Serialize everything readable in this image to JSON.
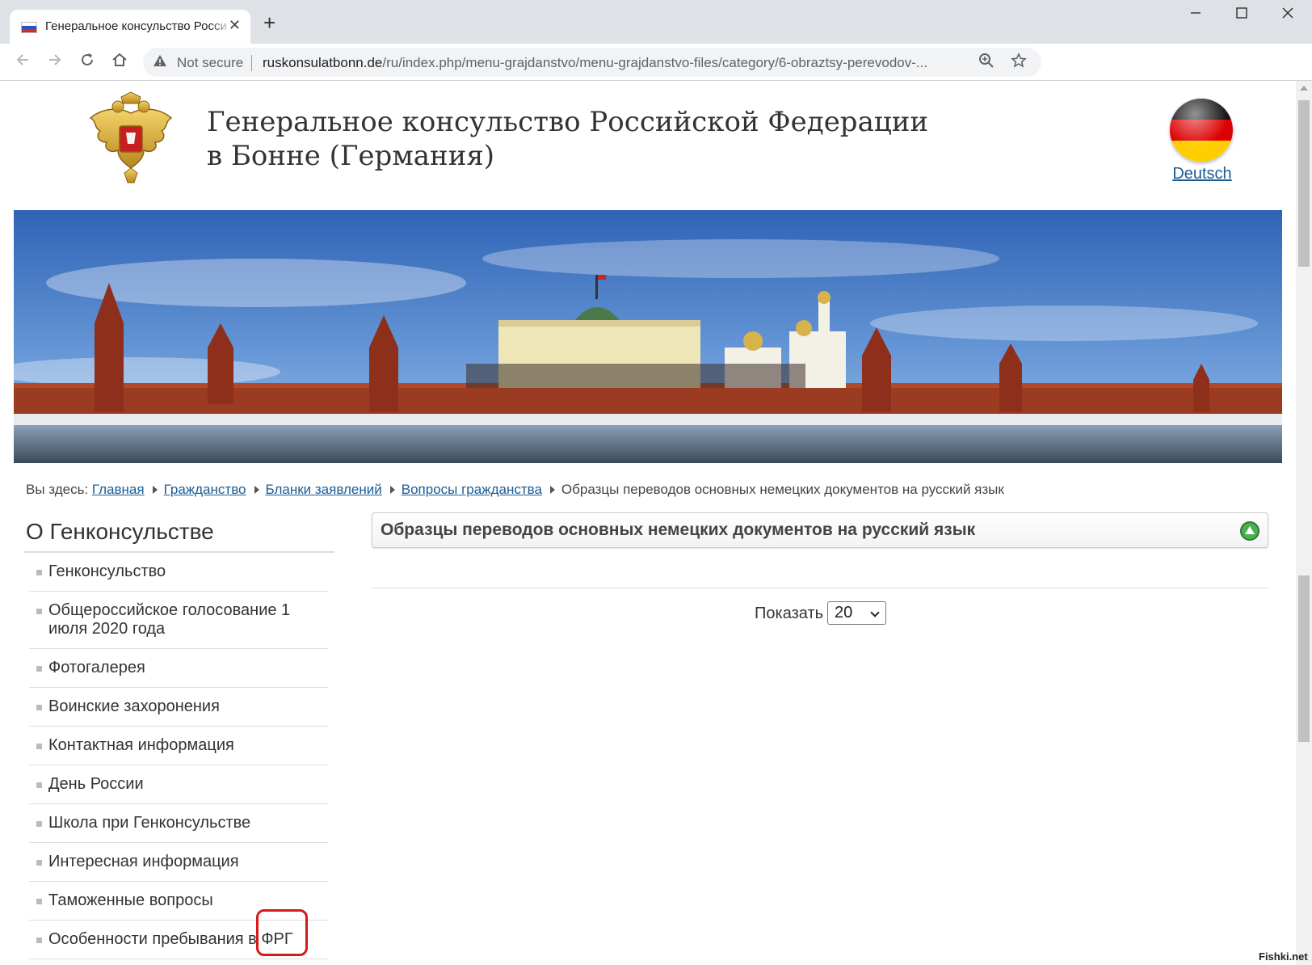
{
  "browser": {
    "tab_title": "Генеральное консульство Росси",
    "new_tab_symbol": "+",
    "security_label": "Not secure",
    "url_host": "ruskonsulatbonn.de",
    "url_path": "/ru/index.php/menu-grajdanstvo/menu-grajdanstvo-files/category/6-obraztsy-perevodov-...",
    "window_controls": [
      "minimize-icon",
      "maximize-icon",
      "close-icon"
    ]
  },
  "header": {
    "title_line1": "Генеральное консульство Российской Федерации",
    "title_line2": "в Бонне (Германия)",
    "language_link": "Deutsch"
  },
  "breadcrumb": {
    "prefix": "Вы здесь:",
    "items": [
      "Главная",
      "Гражданство",
      "Бланки заявлений",
      "Вопросы гражданства"
    ],
    "current": "Образцы переводов основных немецких документов на русский язык"
  },
  "sidebar": {
    "title": "О Генконсульстве",
    "items": [
      {
        "label": "Генконсульство"
      },
      {
        "label": "Общероссийское голосование 1 июля 2020 года"
      },
      {
        "label": "Фотогалерея"
      },
      {
        "label": "Воинские захоронения"
      },
      {
        "label": "Контактная информация"
      },
      {
        "label": "День России"
      },
      {
        "label": "Школа при Генконсульстве"
      },
      {
        "label": "Интересная информация"
      },
      {
        "label": "Таможенные вопросы"
      },
      {
        "label": "Особенности пребывания в ФРГ"
      }
    ]
  },
  "content": {
    "title": "Образцы переводов основных немецких документов на русский язык",
    "show_label": "Показать",
    "show_value": "20"
  },
  "watermark": "Fishki.net",
  "colors": {
    "link": "#1a5c94",
    "highlight": "#d61a1a",
    "accent_green": "#4caf50"
  }
}
